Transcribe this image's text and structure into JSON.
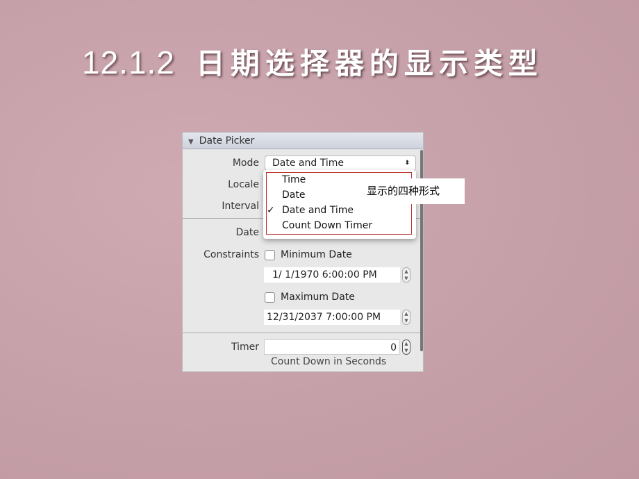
{
  "slide": {
    "title_number": "12.1.2",
    "title_text": "日期选择器的显示类型"
  },
  "inspector": {
    "section_title": "Date Picker",
    "mode": {
      "label": "Mode",
      "value": "Date and Time"
    },
    "locale": {
      "label": "Locale"
    },
    "interval": {
      "label": "Interval"
    },
    "date": {
      "label": "Date"
    },
    "constraints": {
      "label": "Constraints",
      "minimum": {
        "label": "Minimum Date",
        "checked": false,
        "value": "1/  1/1970   6:00:00 PM"
      },
      "maximum": {
        "label": "Maximum Date",
        "checked": false,
        "value": "12/31/2037   7:00:00 PM"
      }
    },
    "timer": {
      "label": "Timer",
      "value": "0",
      "hint": "Count Down in Seconds"
    }
  },
  "mode_menu": {
    "items": [
      "Time",
      "Date",
      "Date and Time",
      "Count Down Timer"
    ],
    "selected": "Date and Time",
    "check_glyph": "✓"
  },
  "annotation": "显示的四种形式"
}
